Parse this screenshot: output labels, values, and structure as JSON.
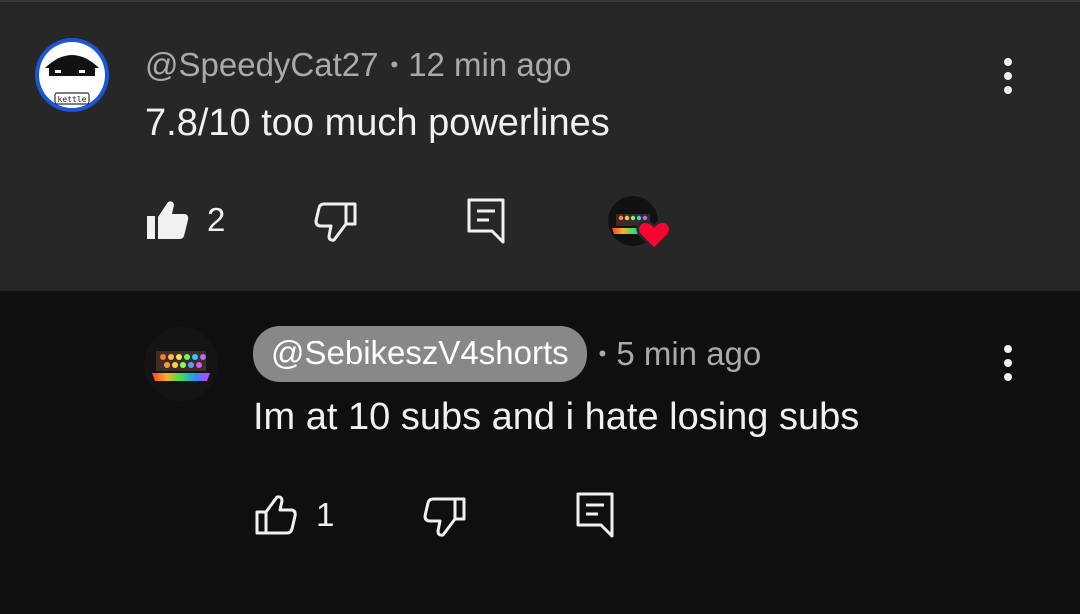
{
  "comments": [
    {
      "author": "@SpeedyCat27",
      "separator": "•",
      "time": "12 min ago",
      "text": "7.8/10 too much powerlines",
      "likes": "2",
      "avatar_label": "kettle",
      "liked": true,
      "creator_hearted": true,
      "icons": [
        "thumb-up-filled-icon",
        "thumb-down-icon",
        "reply-icon",
        "more-vert-icon",
        "heart-icon"
      ]
    },
    {
      "mention": "@SebikeszV4shorts",
      "separator": "•",
      "time": "5 min ago",
      "text": "Im at 10 subs and i hate losing subs",
      "likes": "1",
      "liked": false,
      "icons": [
        "thumb-up-outline-icon",
        "thumb-down-icon",
        "reply-icon",
        "more-vert-icon"
      ]
    }
  ],
  "colors": {
    "parent_bg": "#272727",
    "reply_bg": "#0f0f0f",
    "meta_text": "#aaaaaa",
    "body_text": "#f1f1f1",
    "mention_pill": "#888888",
    "heart": "#ff0033",
    "avatar_ring": "#1a57d6"
  }
}
